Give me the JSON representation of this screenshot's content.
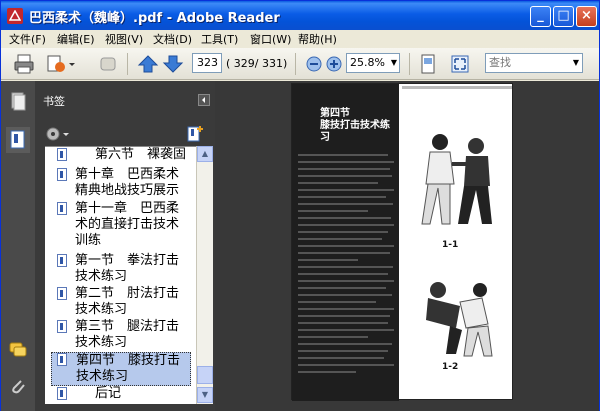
{
  "window": {
    "title": "巴西柔术（魏峰）.pdf - Adobe Reader",
    "minimize": "_",
    "maximize": "□",
    "close": "×"
  },
  "menu": {
    "items": [
      "文件(F)",
      "编辑(E)",
      "视图(V)",
      "文档(D)",
      "工具(T)",
      "窗口(W)",
      "帮助(H)"
    ]
  },
  "toolbar": {
    "page_number": "323",
    "page_total": "( 329/ 331)",
    "zoom": "25.8%",
    "search_placeholder": "查找"
  },
  "bookmarks": {
    "title": "书签",
    "items": [
      {
        "label": "第六节　裸袭固"
      },
      {
        "label": "第十章　巴西柔术精典地战技巧展示"
      },
      {
        "label": "第十一章　巴西柔术的直接打击技术训练"
      },
      {
        "label": "第一节　拳法打击技术练习"
      },
      {
        "label": "第二节　肘法打击技术练习"
      },
      {
        "label": "第三节　腿法打击技术练习"
      },
      {
        "label": "第四节　膝技打击技术练习",
        "selected": true
      },
      {
        "label": "后记"
      }
    ]
  },
  "document": {
    "section_title": "第四节",
    "section_subtitle": "膝技打击技术练习",
    "captions": [
      "1-1",
      "1-2"
    ]
  },
  "colors": {
    "titlebar": "#0a5ce6",
    "panel_dark": "#3a3a3a",
    "selection": "#b6c9ec"
  }
}
